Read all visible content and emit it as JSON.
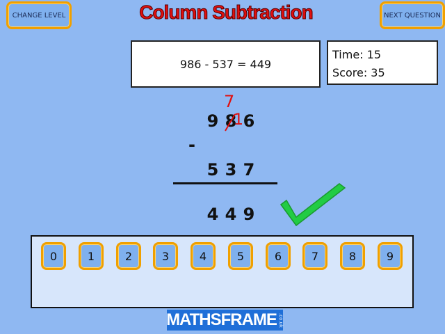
{
  "header": {
    "title": "Column Subtraction",
    "change_level_label": "CHANGE LEVEL",
    "next_question_label": "NEXT QUESTION"
  },
  "question": {
    "equation": "986 - 537 = 449"
  },
  "stats": {
    "time": "Time: 15",
    "score": "Score: 35"
  },
  "working": {
    "top_digits": [
      "9",
      "8",
      "6"
    ],
    "carry_above": "7",
    "carry_into_units": "1",
    "operator": "-",
    "bottom_digits": [
      "5",
      "3",
      "7"
    ],
    "answer_digits": [
      "4",
      "4",
      "9"
    ],
    "feedback_icon": "checkmark-icon"
  },
  "keypad": {
    "keys": [
      "0",
      "1",
      "2",
      "3",
      "4",
      "5",
      "6",
      "7",
      "8",
      "9"
    ]
  },
  "footer": {
    "logo_text": "MATHSFRAME",
    "logo_suffix": ".co.uk"
  },
  "colors": {
    "background": "#8fb8f2",
    "button_border": "#f0a000",
    "title_red": "#e01010",
    "check_green": "#22cc44"
  }
}
